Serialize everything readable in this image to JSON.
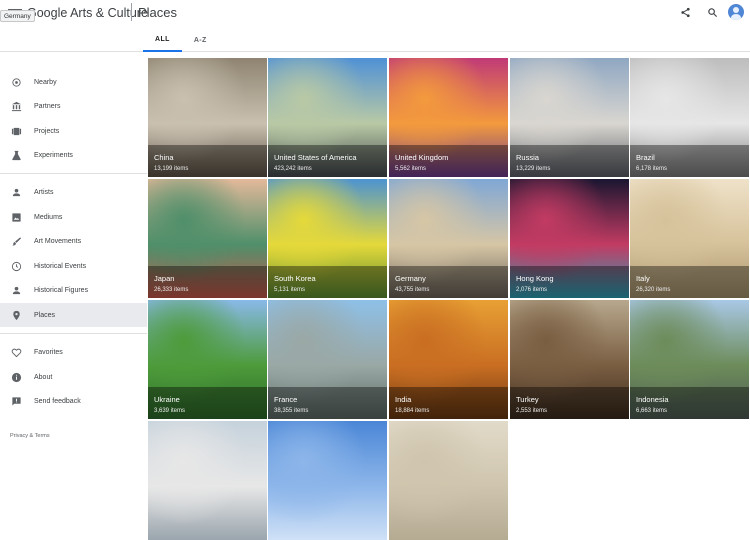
{
  "header": {
    "logo": "Google Arts & Culture",
    "title": "Places",
    "tooltip": "Germany",
    "icons": [
      "menu-icon",
      "share-icon",
      "search-icon",
      "account-avatar"
    ]
  },
  "tabs": [
    {
      "label": "ALL",
      "active": true
    },
    {
      "label": "A-Z",
      "active": false
    }
  ],
  "sidebar": {
    "items": [
      {
        "label": "Nearby",
        "icon": "location-icon"
      },
      {
        "label": "Partners",
        "icon": "museum-icon"
      },
      {
        "label": "Projects",
        "icon": "projects-icon"
      },
      {
        "label": "Experiments",
        "icon": "flask-icon"
      },
      {
        "label": "Artists",
        "icon": "person-icon"
      },
      {
        "label": "Mediums",
        "icon": "image-icon"
      },
      {
        "label": "Art Movements",
        "icon": "brush-icon"
      },
      {
        "label": "Historical Events",
        "icon": "clock-icon"
      },
      {
        "label": "Historical Figures",
        "icon": "person-icon"
      },
      {
        "label": "Places",
        "icon": "pin-icon",
        "active": true
      },
      {
        "label": "Favorites",
        "icon": "heart-icon"
      },
      {
        "label": "About",
        "icon": "info-icon"
      },
      {
        "label": "Send feedback",
        "icon": "feedback-icon"
      }
    ],
    "footer": "Privacy & Terms"
  },
  "places": [
    {
      "name": "China",
      "count": "13,199 items",
      "colors": [
        "#8f8471",
        "#c9c0b0",
        "#5e5346"
      ]
    },
    {
      "name": "United States of America",
      "count": "423,242 items",
      "colors": [
        "#4f91d6",
        "#b9c9a5",
        "#444a4f"
      ]
    },
    {
      "name": "United Kingdom",
      "count": "5,562 items",
      "colors": [
        "#c03a77",
        "#f39a3d",
        "#6b3a8f"
      ]
    },
    {
      "name": "Russia",
      "count": "13,229 items",
      "colors": [
        "#8fa7c2",
        "#d9d6d0",
        "#5a5e66"
      ]
    },
    {
      "name": "Brazil",
      "count": "6,178 items",
      "colors": [
        "#bdbdbd",
        "#e6e6e6",
        "#7a7a7a"
      ]
    },
    {
      "name": "Japan",
      "count": "26,333 items",
      "colors": [
        "#e3b99a",
        "#4f8f6a",
        "#c9574a"
      ]
    },
    {
      "name": "South Korea",
      "count": "5,131 items",
      "colors": [
        "#4c93d1",
        "#e5d93a",
        "#5c8d2f"
      ]
    },
    {
      "name": "Germany",
      "count": "43,755 items",
      "colors": [
        "#7fa7d6",
        "#d6c6a5",
        "#6b6258"
      ]
    },
    {
      "name": "Hong Kong",
      "count": "2,076 items",
      "colors": [
        "#1a1630",
        "#c23b63",
        "#2aa1b6"
      ]
    },
    {
      "name": "Italy",
      "count": "26,320 items",
      "colors": [
        "#efe2c9",
        "#d6c29a",
        "#a8936d"
      ]
    },
    {
      "name": "Ukraine",
      "count": "3,639 items",
      "colors": [
        "#89b9e8",
        "#4d9b3a",
        "#2d6b2a"
      ]
    },
    {
      "name": "France",
      "count": "38,355 items",
      "colors": [
        "#8ec0e8",
        "#9aa8a5",
        "#5c6b66"
      ]
    },
    {
      "name": "India",
      "count": "18,884 items",
      "colors": [
        "#e8a034",
        "#c96e22",
        "#6b3a12"
      ]
    },
    {
      "name": "Turkey",
      "count": "2,553 items",
      "colors": [
        "#b7a88d",
        "#7a5e42",
        "#3d2c1e"
      ]
    },
    {
      "name": "Indonesia",
      "count": "6,663 items",
      "colors": [
        "#a9c8e6",
        "#6d8c5a",
        "#4d5b55"
      ]
    },
    {
      "name": "",
      "count": "",
      "colors": [
        "#c5d2dc",
        "#e7e7e7",
        "#9aa5ad"
      ]
    },
    {
      "name": "",
      "count": "",
      "colors": [
        "#4a86d6",
        "#8db6ea",
        "#cfe1f6"
      ]
    },
    {
      "name": "",
      "count": "",
      "colors": [
        "#e2dac9",
        "#cfc5ae",
        "#b5aa92"
      ]
    }
  ]
}
